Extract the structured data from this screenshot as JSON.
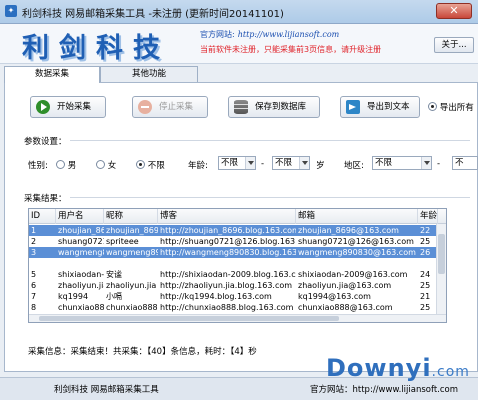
{
  "window": {
    "title": "利剑科技  网易邮箱采集工具 -未注册 (更新时间20141101)",
    "close_glyph": "✕"
  },
  "header": {
    "logo_text": "利剑科技",
    "site_label": "官方网站:",
    "site_url": "http://www.lijiansoft.com",
    "warning": "当前软件未注册，只能采集前3页信息，请升级注册",
    "about_button": "关于..."
  },
  "tabs": [
    {
      "label": "数据采集",
      "active": true
    },
    {
      "label": "其他功能",
      "active": false
    }
  ],
  "toolbar": {
    "start": "开始采集",
    "stop": "停止采集",
    "save_db": "保存到数据库",
    "export_txt": "导出到文本",
    "export_all": "导出所有"
  },
  "params": {
    "section_title": "参数设置：",
    "gender_label": "性别:",
    "gender_options": [
      "男",
      "女",
      "不限"
    ],
    "gender_selected": "不限",
    "age_label": "年龄:",
    "age_from": "不限",
    "age_dash": "-",
    "age_to": "不限",
    "age_unit": "岁",
    "region_label": "地区:",
    "region_province": "不限",
    "region_dash": "-",
    "region_city": "不"
  },
  "results": {
    "section_title": "采集结果：",
    "columns": [
      "ID",
      "用户名",
      "昵称",
      "博客",
      "邮箱",
      "年龄"
    ],
    "rows": [
      {
        "id": "1",
        "user": "zhoujian_8696",
        "nick": "zhoujian_8696",
        "blog": "http://zhoujian_8696.blog.163.com",
        "email": "zhoujian_8696@163.com",
        "age": "22",
        "selected": true
      },
      {
        "id": "2",
        "user": "shuang0721...",
        "nick": "spriteee",
        "blog": "http://shuang0721@126.blog.163.com",
        "email": "shuang0721@126@163.com",
        "age": "25",
        "selected": false
      },
      {
        "id": "3",
        "user": "wangmeng89...",
        "nick": "wangmeng89...",
        "blog": "http://wangmeng890830.blog.163.com",
        "email": "wangmeng890830@163.com",
        "age": "26",
        "selected": true
      },
      {
        "id": "",
        "user": "",
        "nick": "",
        "blog": "",
        "email": "",
        "age": "",
        "selected": false
      },
      {
        "id": "5",
        "user": "shixiaodan-...",
        "nick": "安谧",
        "blog": "http://shixiaodan-2009.blog.163.com",
        "email": "shixiaodan-2009@163.com",
        "age": "24",
        "selected": false
      },
      {
        "id": "6",
        "user": "zhaoliyun.jia",
        "nick": "zhaoliyun.jia",
        "blog": "http://zhaoliyun.jia.blog.163.com",
        "email": "zhaoliyun.jia@163.com",
        "age": "25",
        "selected": false
      },
      {
        "id": "7",
        "user": "kq1994",
        "nick": "小嗝",
        "blog": "http://kq1994.blog.163.com",
        "email": "kq1994@163.com",
        "age": "21",
        "selected": false
      },
      {
        "id": "8",
        "user": "chunxiao888",
        "nick": "chunxiao888",
        "blog": "http://chunxiao888.blog.163.com",
        "email": "chunxiao888@163.com",
        "age": "25",
        "selected": false
      }
    ]
  },
  "collect_info": "采集信息：采集结束！共采集：【40】条信息，耗时：【4】秒",
  "statusbar": {
    "left": "利剑科技  网易邮箱采集工具",
    "right": "官方网站：http://www.lijiansoft.com"
  },
  "watermark": {
    "main": "Downyi",
    "suffix": ".com"
  },
  "colors": {
    "accent": "#1f5fb4",
    "warning": "#e0242b",
    "selection": "#5b8fd6"
  }
}
